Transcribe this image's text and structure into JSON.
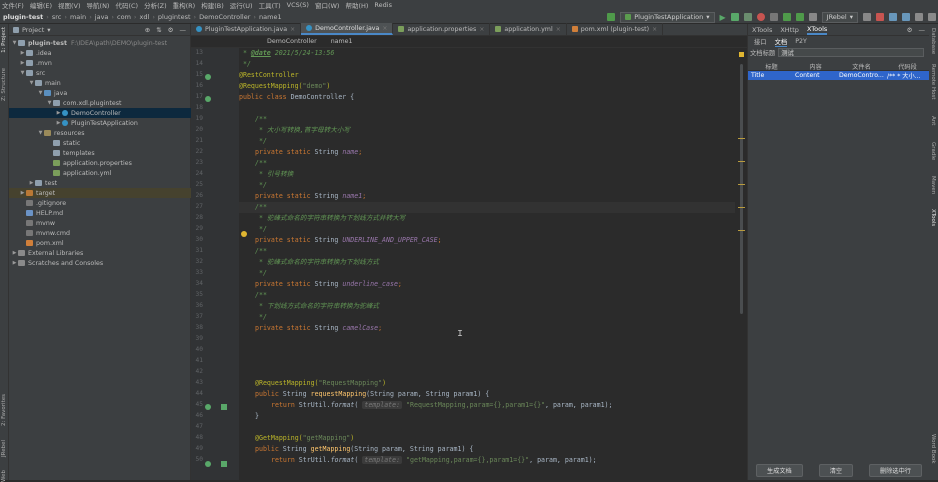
{
  "menu": [
    "文件(F)",
    "编辑(E)",
    "视图(V)",
    "导航(N)",
    "代码(C)",
    "分析(Z)",
    "重构(R)",
    "构建(B)",
    "运行(U)",
    "工具(T)",
    "VCS(S)",
    "窗口(W)",
    "帮助(H)",
    "Redis"
  ],
  "breadcrumb": [
    "plugin-test",
    "src",
    "main",
    "java",
    "com",
    "xdl",
    "plugintest",
    "DemoController",
    "name1"
  ],
  "toolbar": {
    "run_config": "PluginTestApplication",
    "jrebel": "JRebel"
  },
  "left_strip": {
    "structure": "Z: Structure",
    "favorites": "2: Favorites",
    "jrebel": "JRebel",
    "web": "Web"
  },
  "right_strip": {
    "database": "Database",
    "maven": "Maven",
    "ant": "Ant",
    "remote_host": "Remote Host",
    "gradle": "Gradle",
    "xtools": "XTools",
    "word_book": "Word Book"
  },
  "project": {
    "title": "Project",
    "tree": [
      {
        "label": "plugin-test",
        "extra": "F:\\IDEA\\path\\DEMO\\plugin-test",
        "bold": true
      },
      {
        "label": ".idea"
      },
      {
        "label": ".mvn"
      },
      {
        "label": "src"
      },
      {
        "label": "main"
      },
      {
        "label": "java"
      },
      {
        "label": "com.xdl.plugintest"
      },
      {
        "label": "DemoController"
      },
      {
        "label": "PluginTestApplication"
      },
      {
        "label": "resources"
      },
      {
        "label": "static"
      },
      {
        "label": "templates"
      },
      {
        "label": "application.properties"
      },
      {
        "label": "application.yml"
      },
      {
        "label": "test"
      },
      {
        "label": "target"
      },
      {
        "label": ".gitignore"
      },
      {
        "label": "HELP.md"
      },
      {
        "label": "mvnw"
      },
      {
        "label": "mvnw.cmd"
      },
      {
        "label": "pom.xml"
      },
      {
        "label": "External Libraries"
      },
      {
        "label": "Scratches and Consoles"
      }
    ]
  },
  "tabs": [
    "PluginTestApplication.java",
    "DemoController.java",
    "application.properties",
    "application.yml",
    "pom.xml (plugin-test)"
  ],
  "editor_crumbs": [
    "DemoController",
    "name1"
  ],
  "code": {
    "line_numbers": [
      "13",
      "14",
      "15",
      "16",
      "17",
      "18",
      "19",
      "20",
      "21",
      "22",
      "23",
      "24",
      "25",
      "26",
      "27",
      "28",
      "29",
      "30",
      "31",
      "32",
      "33",
      "34",
      "35",
      "36",
      "37",
      "38",
      "39",
      "40",
      "41",
      "42",
      "43",
      "44",
      "45",
      "46",
      "47",
      "48",
      "49",
      "50"
    ],
    "l13_tag": "@date",
    "l13_val": " 2021/5/24-13:56",
    "l14": " */",
    "l15": "@RestController",
    "l16_ann": "@RequestMapping(",
    "l16_str": "\"demo\"",
    "l16_end": ")",
    "l17_kw": "public class ",
    "l17_name": "DemoController {",
    "l19": "/**",
    "l20": " * 大小写转换,首字母转大小写",
    "l21": " */",
    "kw_private": "private static ",
    "type_string": "String ",
    "f_name": "name",
    "f_name1": "name1",
    "f_upper": "UNDERLINE_AND_UPPER_CASE",
    "f_underline": "underline_case",
    "f_camel": "camelCase",
    "c23": " * 引号转换",
    "c28": " * 驼峰式命名的字符串转换为下划线方式并转大写",
    "c33": " * 驼峰式命名的字符串转换为下划线方式",
    "c38": " * 下划线方式命名的字符串转换为驼峰式",
    "semi": ";",
    "m1_ann": "@RequestMapping(",
    "m1_str": "\"RequestMapping\"",
    "m1_end": ")",
    "m_public": "public ",
    "m_sig_type": "String ",
    "m1_name": "requestMapping",
    "m_params": "(String param, String param1) {",
    "ret": "return ",
    "strutil": "StrUtil.",
    "format": "format",
    "hint": "template:",
    "m1_fmt": "\"RequestMapping,param={},param1={}\"",
    "args": ", param, param1);",
    "close": "}",
    "m2_ann": "@GetMapping(",
    "m2_str": "\"getMapping\"",
    "m2_end": ")",
    "m2_name": "getMapping",
    "m2_fmt": "\"getMapping,param={},param1={}\""
  },
  "right_panel": {
    "tabs": [
      "XTools",
      "XHttp",
      "XTools"
    ],
    "subtabs": [
      "接口",
      "文档",
      "P2Y"
    ],
    "form_label": "文档标题",
    "form_value": "测试",
    "columns": [
      "标题",
      "内容",
      "文件名",
      "代码段"
    ],
    "rows": [
      [
        "Title",
        "Content",
        "DemoContro...",
        "/** * 大小..."
      ]
    ],
    "buttons": [
      "生成文档",
      "清空",
      "删除选中行"
    ]
  },
  "colors": {
    "accent": "#4a88c7",
    "selection": "#2f65ca"
  }
}
